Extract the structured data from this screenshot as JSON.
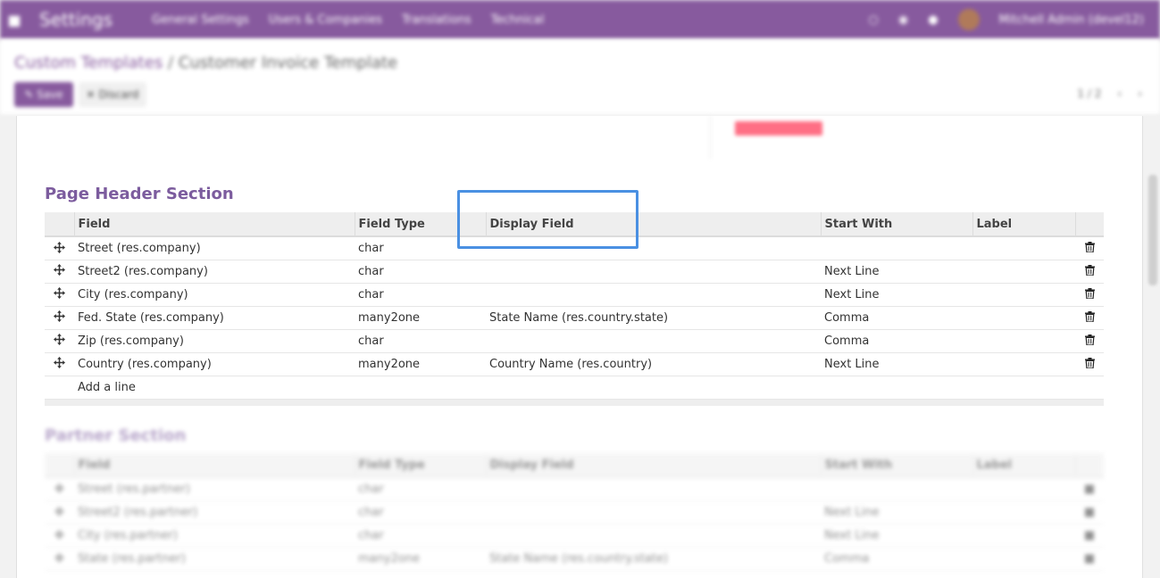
{
  "navbar": {
    "app_name": "Settings",
    "menus": [
      "General Settings",
      "Users & Companies",
      "Translations",
      "Technical"
    ],
    "user_name": "Mitchell Admin (devel12)"
  },
  "breadcrumb": {
    "parent": "Custom Templates",
    "separator": "/",
    "current": "Customer Invoice Template"
  },
  "buttons": {
    "save": "Save",
    "discard": "Discard"
  },
  "pager": {
    "value": "1 / 2"
  },
  "page_header": {
    "title": "Page Header Section",
    "columns": [
      "Field",
      "Field Type",
      "Display Field",
      "Start With",
      "Label"
    ],
    "rows": [
      {
        "field": "Street (res.company)",
        "type": "char",
        "display": "",
        "start": "",
        "label": ""
      },
      {
        "field": "Street2 (res.company)",
        "type": "char",
        "display": "",
        "start": "Next Line",
        "label": ""
      },
      {
        "field": "City (res.company)",
        "type": "char",
        "display": "",
        "start": "Next Line",
        "label": ""
      },
      {
        "field": "Fed. State (res.company)",
        "type": "many2one",
        "display": "State Name (res.country.state)",
        "start": "Comma",
        "label": ""
      },
      {
        "field": "Zip (res.company)",
        "type": "char",
        "display": "",
        "start": "Comma",
        "label": ""
      },
      {
        "field": "Country (res.company)",
        "type": "many2one",
        "display": "Country Name (res.country)",
        "start": "Next Line",
        "label": ""
      }
    ],
    "add_line": "Add a line"
  },
  "partner": {
    "title": "Partner Section",
    "columns": [
      "Field",
      "Field Type",
      "Display Field",
      "Start With",
      "Label"
    ],
    "rows": [
      {
        "field": "Street (res.partner)",
        "type": "char",
        "display": "",
        "start": "",
        "label": ""
      },
      {
        "field": "Street2 (res.partner)",
        "type": "char",
        "display": "",
        "start": "Next Line",
        "label": ""
      },
      {
        "field": "City (res.partner)",
        "type": "char",
        "display": "",
        "start": "Next Line",
        "label": ""
      },
      {
        "field": "State (res.partner)",
        "type": "many2one",
        "display": "State Name (res.country.state)",
        "start": "Comma",
        "label": ""
      }
    ]
  },
  "colors": {
    "brand": "#875a9e",
    "highlight": "#4a90e2",
    "badge": "#ff6f85"
  },
  "icons": {
    "home": "home-icon",
    "handle": "drag-handle-icon",
    "delete": "trash-icon"
  }
}
